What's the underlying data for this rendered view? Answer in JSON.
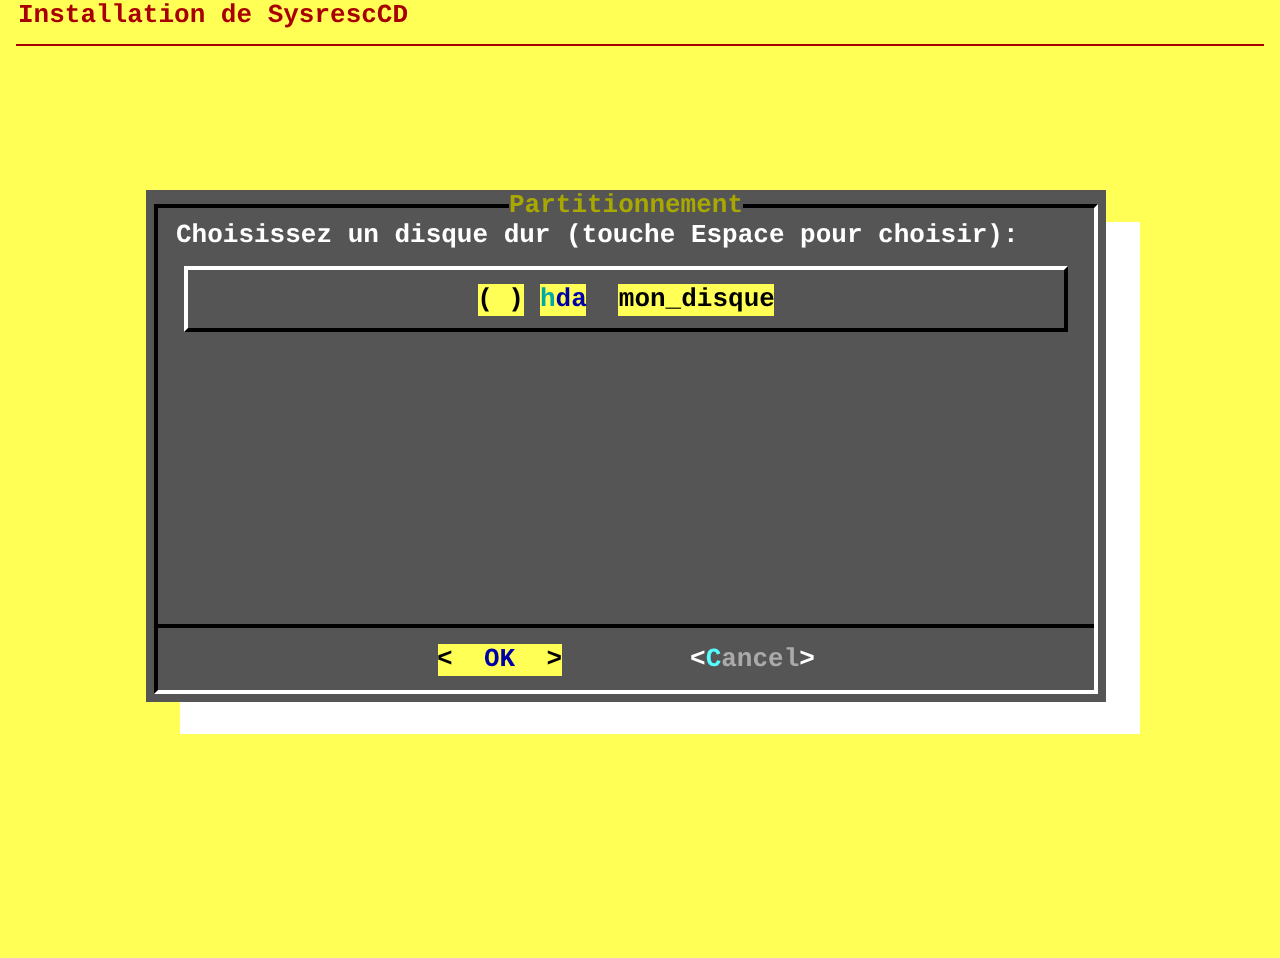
{
  "window": {
    "title": "Installation de SysrescCD"
  },
  "dialog": {
    "title": "Partitionnement",
    "prompt": "Choisissez un disque dur (touche Espace pour choisir):",
    "items": [
      {
        "marker": "( )",
        "tag": "hda",
        "description": "mon_disque",
        "checked": false,
        "selected": true
      }
    ],
    "buttons": [
      {
        "left": "<",
        "label": "OK",
        "right": ">",
        "selected": true
      },
      {
        "left": "<",
        "label": "Cancel",
        "right": ">",
        "selected": false
      }
    ]
  }
}
